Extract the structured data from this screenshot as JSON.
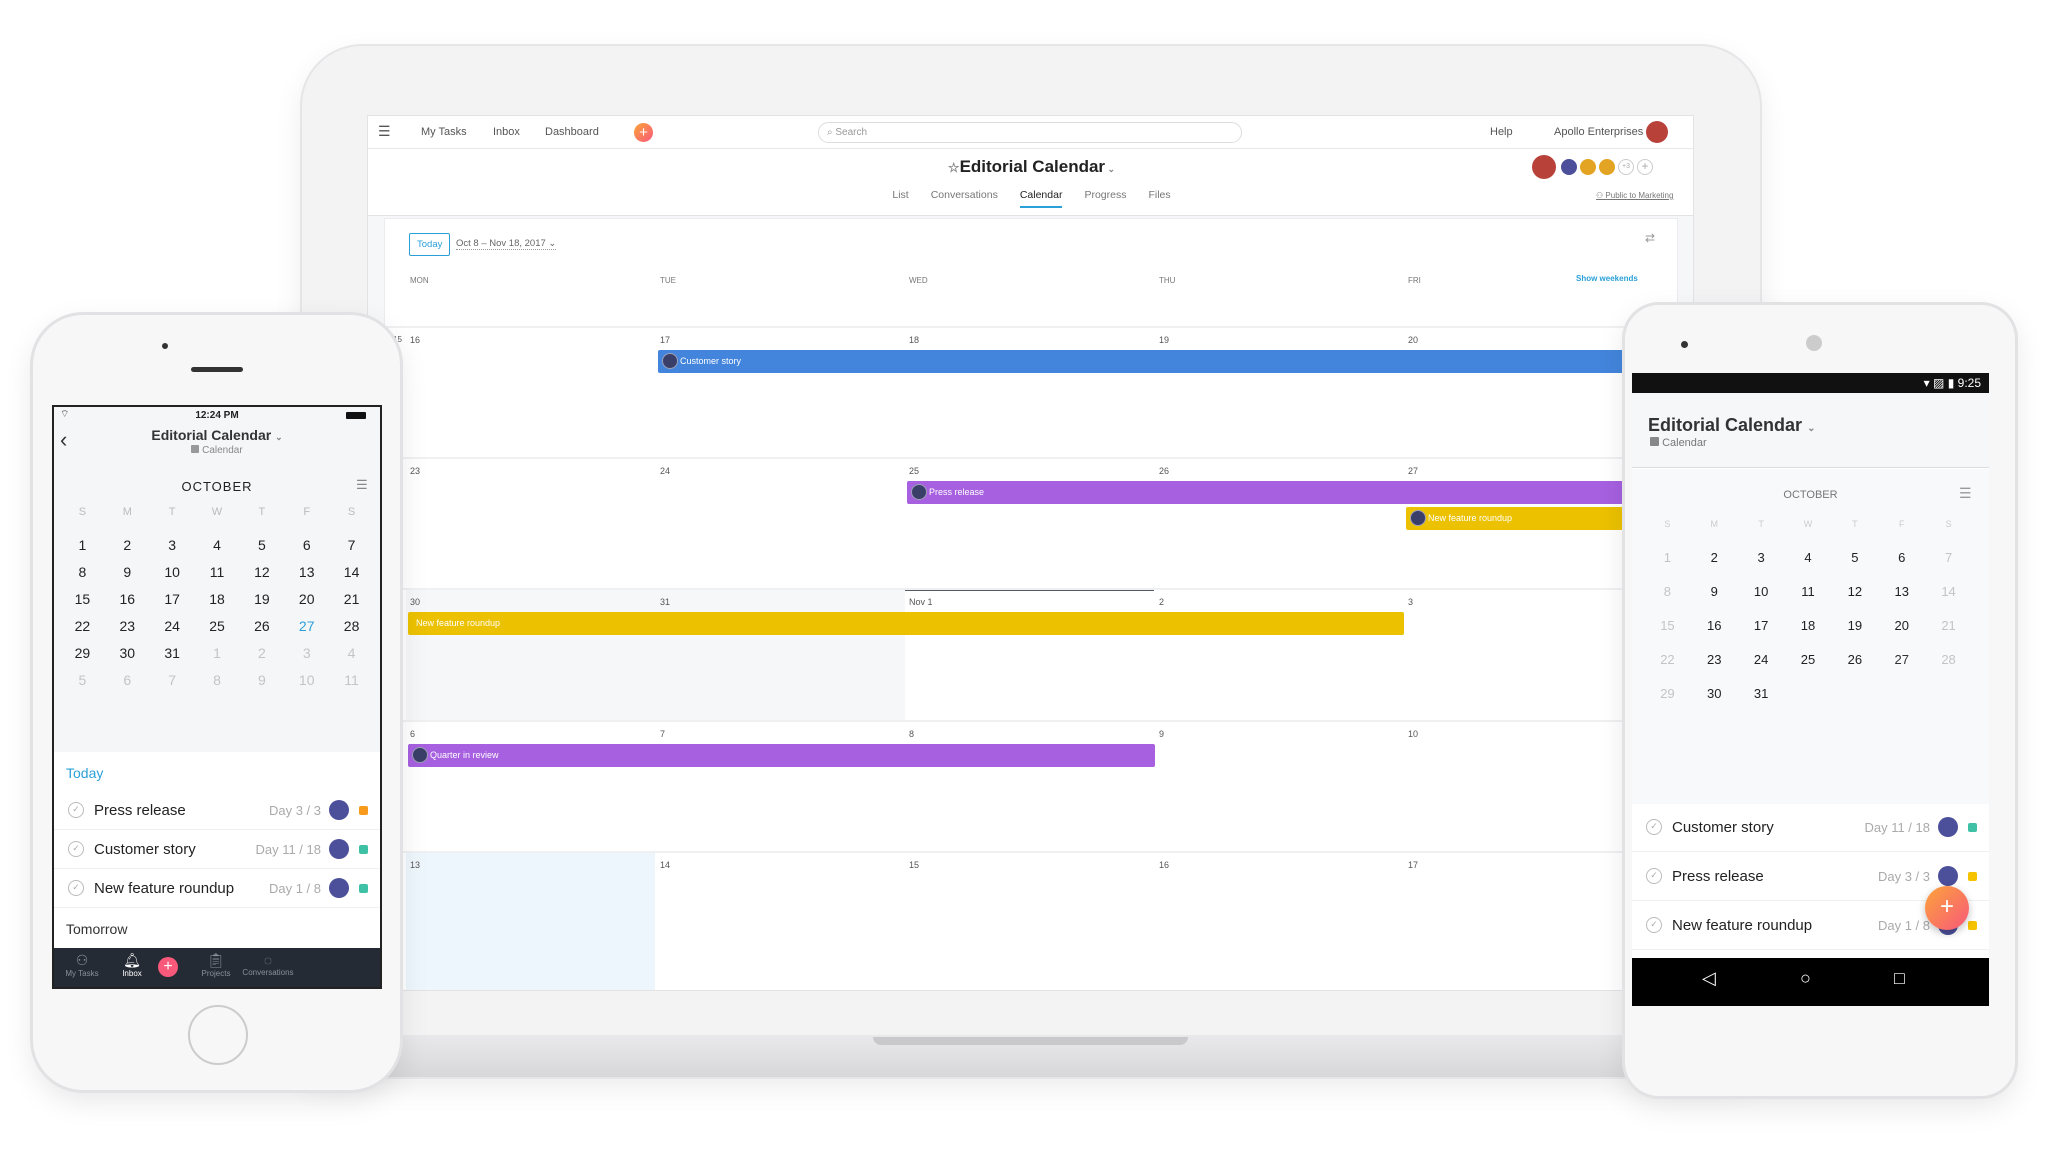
{
  "colors": {
    "blue": "#4385dc",
    "purple": "#a660e0",
    "yellow": "#ecc100",
    "teal": "#3fc1a6",
    "orange": "#f89a1c",
    "accent": "#2ba0d8"
  },
  "desktop": {
    "nav": {
      "menu_icon": "hamburger-icon",
      "items": [
        "My Tasks",
        "Inbox",
        "Dashboard"
      ],
      "search_placeholder": "Search",
      "help": "Help",
      "org": "Apollo Enterprises"
    },
    "project": {
      "title": "Editorial Calendar",
      "members_more": "+3",
      "visibility": "Public to Marketing",
      "tabs": [
        "List",
        "Conversations",
        "Calendar",
        "Progress",
        "Files"
      ],
      "active_tab": "Calendar"
    },
    "toolbar": {
      "today": "Today",
      "range": "Oct 8 – Nov 18, 2017"
    },
    "weekdays": [
      "MON",
      "TUE",
      "WED",
      "THU",
      "FRI"
    ],
    "show_weekends": "Show weekends",
    "weeks": [
      [
        "16",
        "17",
        "18",
        "19",
        "20"
      ],
      [
        "23",
        "24",
        "25",
        "26",
        "27"
      ],
      [
        "30",
        "31",
        "Nov 1",
        "2",
        "3"
      ],
      [
        "6",
        "7",
        "8",
        "9",
        "10"
      ],
      [
        "13",
        "14",
        "15",
        "16",
        "17"
      ]
    ],
    "hidden_day": "15",
    "events": [
      {
        "title": "Customer story",
        "color": "blue",
        "start": "Oct 17",
        "end": "Oct 20+"
      },
      {
        "title": "Press release",
        "color": "purple",
        "start": "Oct 25",
        "end": "Oct 27+"
      },
      {
        "title": "New feature roundup",
        "color": "yellow",
        "start": "Oct 27",
        "end": "Oct 27+"
      },
      {
        "title": "New feature roundup",
        "color": "yellow",
        "start": "Oct 30",
        "end": "Nov 2"
      },
      {
        "title": "Quarter in review",
        "color": "purple",
        "start": "Nov 6",
        "end": "Nov 8"
      }
    ]
  },
  "iphone": {
    "status": {
      "time": "12:24 PM"
    },
    "title": "Editorial Calendar",
    "subtitle": "Calendar",
    "month": "OCTOBER",
    "weekdays": [
      "S",
      "M",
      "T",
      "W",
      "T",
      "F",
      "S"
    ],
    "days": [
      "1",
      "2",
      "3",
      "4",
      "5",
      "6",
      "7",
      "8",
      "9",
      "10",
      "11",
      "12",
      "13",
      "14",
      "15",
      "16",
      "17",
      "18",
      "19",
      "20",
      "21",
      "22",
      "23",
      "24",
      "25",
      "26",
      "27",
      "28",
      "29",
      "30",
      "31",
      "1",
      "2",
      "3",
      "4",
      "5",
      "6",
      "7",
      "8",
      "9",
      "10",
      "11"
    ],
    "today": "27",
    "section_today": "Today",
    "tasks": [
      {
        "name": "Press release",
        "day": "Day 3 / 3",
        "color": "#f89a1c"
      },
      {
        "name": "Customer story",
        "day": "Day 11 / 18",
        "color": "#3fc1a6"
      },
      {
        "name": "New feature roundup",
        "day": "Day 1 / 8",
        "color": "#3fc1a6"
      }
    ],
    "section_tomorrow": "Tomorrow",
    "tabbar": [
      "My Tasks",
      "Inbox",
      "Projects",
      "Conversations"
    ]
  },
  "android": {
    "status": {
      "time": "9:25"
    },
    "title": "Editorial Calendar",
    "subtitle": "Calendar",
    "month": "OCTOBER",
    "weekdays": [
      "S",
      "M",
      "T",
      "W",
      "T",
      "F",
      "S"
    ],
    "days": [
      "1",
      "2",
      "3",
      "4",
      "5",
      "6",
      "7",
      "8",
      "9",
      "10",
      "11",
      "12",
      "13",
      "14",
      "15",
      "16",
      "17",
      "18",
      "19",
      "20",
      "21",
      "22",
      "23",
      "24",
      "25",
      "26",
      "27",
      "28",
      "29",
      "30",
      "31"
    ],
    "today": "27",
    "tasks": [
      {
        "name": "Customer story",
        "day": "Day 11 / 18",
        "color": "#3fc1a6"
      },
      {
        "name": "Press release",
        "day": "Day 3 / 3",
        "color": "#f5c300"
      },
      {
        "name": "New feature roundup",
        "day": "Day 1 / 8",
        "color": "#f5c300"
      }
    ]
  }
}
